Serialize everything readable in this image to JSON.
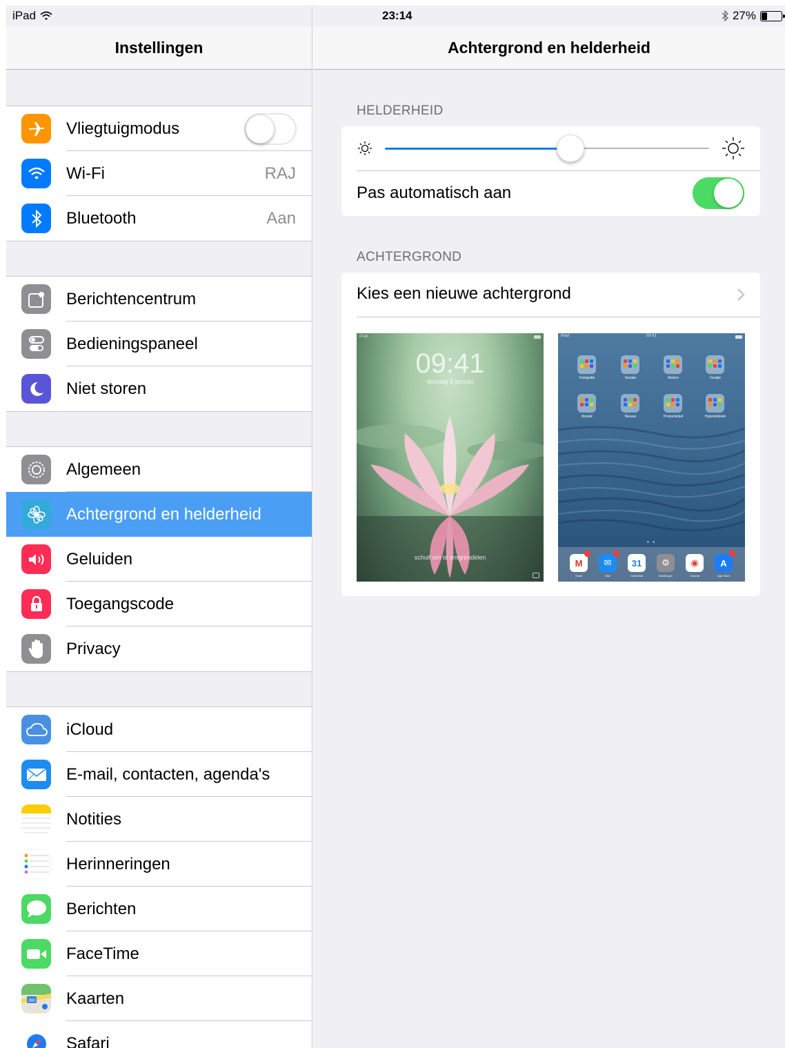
{
  "status_bar": {
    "device": "iPad",
    "time": "23:14",
    "battery_percent": "27%",
    "battery_level": 0.27,
    "icons": [
      "wifi-icon",
      "bluetooth-icon",
      "battery-icon"
    ]
  },
  "master": {
    "title": "Instellingen",
    "groups": [
      [
        {
          "label": "Vliegtuigmodus",
          "icon": "airplane-icon",
          "color": "#ff9500",
          "toggle": false
        },
        {
          "label": "Wi-Fi",
          "icon": "wifi-icon",
          "color": "#007aff",
          "value": "RAJ"
        },
        {
          "label": "Bluetooth",
          "icon": "bluetooth-icon",
          "color": "#007aff",
          "value": "Aan"
        }
      ],
      [
        {
          "label": "Berichtencentrum",
          "icon": "notification-center-icon",
          "color": "#8e8e93"
        },
        {
          "label": "Bedieningspaneel",
          "icon": "control-center-icon",
          "color": "#8e8e93"
        },
        {
          "label": "Niet storen",
          "icon": "moon-icon",
          "color": "#5856d6"
        }
      ],
      [
        {
          "label": "Algemeen",
          "icon": "gear-icon",
          "color": "#8e8e93"
        },
        {
          "label": "Achtergrond en helderheid",
          "icon": "wallpaper-icon",
          "color": "#34aadc",
          "selected": true
        },
        {
          "label": "Geluiden",
          "icon": "speaker-icon",
          "color": "#ff2d55"
        },
        {
          "label": "Toegangscode",
          "icon": "lock-icon",
          "color": "#ff2d55"
        },
        {
          "label": "Privacy",
          "icon": "hand-icon",
          "color": "#8e8e93"
        }
      ],
      [
        {
          "label": "iCloud",
          "icon": "cloud-icon",
          "color": "#4a90e2"
        },
        {
          "label": "E-mail, contacten, agenda's",
          "icon": "mail-icon",
          "color": "#1d8cf0"
        },
        {
          "label": "Notities",
          "icon": "notes-icon",
          "color": "#ffcc00"
        },
        {
          "label": "Herinneringen",
          "icon": "reminders-icon",
          "color": "#ffffff"
        },
        {
          "label": "Berichten",
          "icon": "messages-icon",
          "color": "#4cd964"
        },
        {
          "label": "FaceTime",
          "icon": "facetime-icon",
          "color": "#4cd964"
        },
        {
          "label": "Kaarten",
          "icon": "maps-icon",
          "color": "#9fd5f0"
        },
        {
          "label": "Safari",
          "icon": "safari-icon",
          "color": "#1e7cf2"
        }
      ]
    ]
  },
  "detail": {
    "title": "Achtergrond en helderheid",
    "brightness": {
      "header": "HELDERHEID",
      "level": 0.55,
      "auto_label": "Pas automatisch aan",
      "auto": true
    },
    "wallpaper": {
      "header": "ACHTERGROND",
      "choose_label": "Kies een nieuwe achtergrond",
      "lock_preview": {
        "time": "09:41",
        "date": "dinsdag 8 januari",
        "slide_text": "schuif om te ontgrendelen"
      },
      "home_preview": {
        "status_left": "iPad",
        "status_center": "09:41",
        "folders": [
          "Fotografie",
          "Sociale",
          "Reizen",
          "Google",
          "Muziek",
          "Nieuws",
          "Productiviteit",
          "Hulpmiddelen"
        ],
        "dock": [
          {
            "name": "Gmail",
            "glyph": "M"
          },
          {
            "name": "Mail",
            "glyph": "✉"
          },
          {
            "name": "CalenMob",
            "glyph": "31"
          },
          {
            "name": "Instellingen",
            "glyph": "⚙"
          },
          {
            "name": "Chrome",
            "glyph": "◉"
          },
          {
            "name": "App Store",
            "glyph": "A"
          }
        ]
      }
    }
  }
}
